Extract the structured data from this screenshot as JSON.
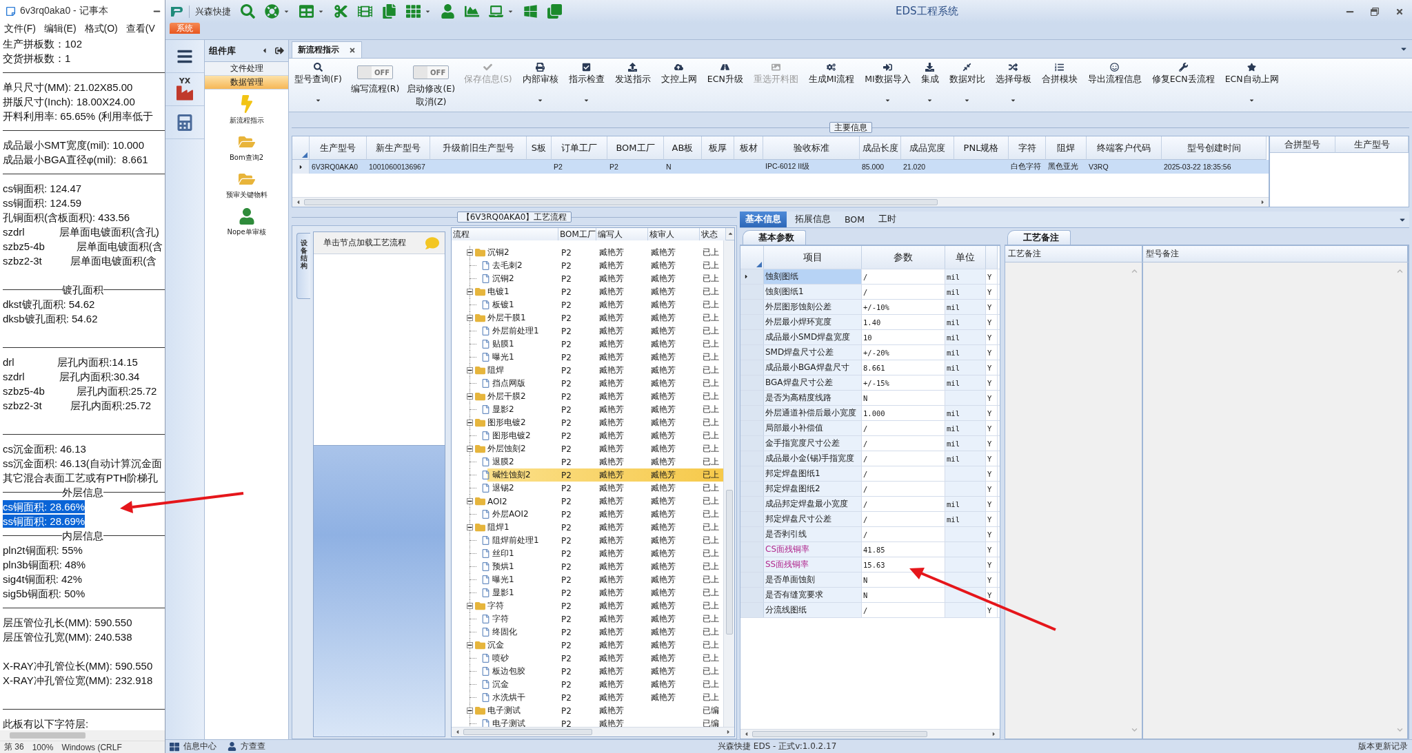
{
  "notepad": {
    "title": "6v3rq0aka0 - 记事本",
    "menu": [
      "文件(F)",
      "编辑(E)",
      "格式(O)",
      "查看(V"
    ],
    "lines": [
      {
        "kind": "text",
        "text": "生产拼板数：102",
        "selected": false
      },
      {
        "kind": "text",
        "text": "交货拼板数：1",
        "selected": false
      },
      {
        "kind": "rule"
      },
      {
        "kind": "text",
        "text": "单只尺寸(MM): 21.02X85.00",
        "selected": false
      },
      {
        "kind": "text",
        "text": "拼版尺寸(Inch): 18.00X24.00",
        "selected": false
      },
      {
        "kind": "text",
        "text": "开料利用率: 65.65% (利用率低于",
        "selected": false
      },
      {
        "kind": "rule"
      },
      {
        "kind": "text",
        "text": "成品最小SMT宽度(mil): 10.000",
        "selected": false
      },
      {
        "kind": "text",
        "text": "成品最小BGA直径φ(mil):  8.661",
        "selected": false
      },
      {
        "kind": "rule"
      },
      {
        "kind": "text",
        "text": "cs铜面积: 124.47",
        "selected": false
      },
      {
        "kind": "text",
        "text": "ss铜面积: 124.59",
        "selected": false
      },
      {
        "kind": "text",
        "text": "孔铜面积(含板面积): 433.56",
        "selected": false
      },
      {
        "kind": "text",
        "text": "szdrl            层单面电镀面积(含孔)",
        "selected": false
      },
      {
        "kind": "text",
        "text": "szbz5-4b           层单面电镀面积(含",
        "selected": false
      },
      {
        "kind": "text",
        "text": "szbz2-3t          层单面电镀面积(含",
        "selected": false
      },
      {
        "kind": "blank"
      },
      {
        "kind": "heading",
        "text": "镀孔面积"
      },
      {
        "kind": "text",
        "text": "dkst镀孔面积: 54.62",
        "selected": false
      },
      {
        "kind": "text",
        "text": "dksb镀孔面积: 54.62",
        "selected": false
      },
      {
        "kind": "blank"
      },
      {
        "kind": "rule"
      },
      {
        "kind": "text",
        "text": "drl               层孔内面积:14.15",
        "selected": false
      },
      {
        "kind": "text",
        "text": "szdrl            层孔内面积:30.34",
        "selected": false
      },
      {
        "kind": "text",
        "text": "szbz5-4b           层孔内面积:25.72",
        "selected": false
      },
      {
        "kind": "text",
        "text": "szbz2-3t          层孔内面积:25.72",
        "selected": false
      },
      {
        "kind": "blank"
      },
      {
        "kind": "rule"
      },
      {
        "kind": "text",
        "text": "cs沉金面积: 46.13",
        "selected": false
      },
      {
        "kind": "text",
        "text": "ss沉金面积: 46.13(自动计算沉金面",
        "selected": false
      },
      {
        "kind": "text",
        "text": "其它混合表面工艺或有PTH阶梯孔",
        "selected": false
      },
      {
        "kind": "heading",
        "text": "外层信息"
      },
      {
        "kind": "text",
        "text": "cs铜面积: 28.66%",
        "selected": true
      },
      {
        "kind": "text",
        "text": "ss铜面积: 28.69%",
        "selected": true
      },
      {
        "kind": "heading",
        "text": "内层信息"
      },
      {
        "kind": "text",
        "text": "pln2t铜面积: 55%",
        "selected": false
      },
      {
        "kind": "text",
        "text": "pln3b铜面积: 48%",
        "selected": false
      },
      {
        "kind": "text",
        "text": "sig4t铜面积: 42%",
        "selected": false
      },
      {
        "kind": "text",
        "text": "sig5b铜面积: 50%",
        "selected": false
      },
      {
        "kind": "rule"
      },
      {
        "kind": "text",
        "text": "层压管位孔长(MM): 590.550",
        "selected": false
      },
      {
        "kind": "text",
        "text": "层压管位孔宽(MM): 240.538",
        "selected": false
      },
      {
        "kind": "blank"
      },
      {
        "kind": "text",
        "text": "X-RAY冲孔管位长(MM): 590.550",
        "selected": false
      },
      {
        "kind": "text",
        "text": "X-RAY冲孔管位宽(MM): 232.918",
        "selected": false
      },
      {
        "kind": "blank"
      },
      {
        "kind": "rule"
      },
      {
        "kind": "text",
        "text": "此板有以下字符层:",
        "selected": false
      }
    ],
    "status": [
      "第 36",
      "100%",
      "Windows (CRLF"
    ]
  },
  "app": {
    "logo_text": "兴森快捷",
    "title": "EDS工程系统",
    "quick_tools": [
      {
        "dropdown": false
      },
      {
        "dropdown": true
      },
      {
        "dropdown": true
      },
      {
        "dropdown": false
      },
      {
        "dropdown": false
      },
      {
        "dropdown": false
      },
      {
        "dropdown": true
      },
      {
        "dropdown": false
      },
      {
        "dropdown": false
      },
      {
        "dropdown": true
      },
      {
        "dropdown": false
      },
      {
        "dropdown": false
      }
    ],
    "ribbon_tabs": [
      {
        "label": "系统",
        "selected": true
      }
    ],
    "sidebar_icons": [
      {
        "kind": "menu"
      },
      {
        "kind": "factory",
        "badge": "YX"
      },
      {
        "kind": "calculator"
      }
    ],
    "component_library": {
      "title": "组件库",
      "categories": [
        {
          "label": "文件处理",
          "selected": false
        },
        {
          "label": "数据管理",
          "selected": true
        }
      ],
      "items": [
        {
          "kind": "bolt",
          "label": "新流程指示"
        },
        {
          "kind": "folder",
          "label": "Bom查询2"
        },
        {
          "kind": "folder",
          "label": "预审关键物料"
        },
        {
          "kind": "user",
          "label": "Nope单审核"
        }
      ]
    },
    "doc_tabs": [
      {
        "label": "新流程指示",
        "selected": true
      }
    ],
    "toolbar": [
      {
        "kind": "button",
        "label": "型号查询(F)",
        "dropdown": true,
        "disabled": false
      },
      {
        "kind": "toggle",
        "label": "编写流程(R)",
        "state_label": "OFF",
        "on": false
      },
      {
        "kind": "toggle",
        "label": "启动修改(E)",
        "sublabel": "取消(Z)",
        "state_label": "OFF",
        "on": false
      },
      {
        "kind": "button",
        "label": "保存信息(S)",
        "dropdown": false,
        "disabled": true
      },
      {
        "kind": "button",
        "label": "内部审核",
        "dropdown": true,
        "disabled": false
      },
      {
        "kind": "button",
        "label": "指示检查",
        "dropdown": true,
        "disabled": false
      },
      {
        "kind": "button",
        "label": "发送指示",
        "dropdown": false,
        "disabled": false
      },
      {
        "kind": "button",
        "label": "文控上网",
        "dropdown": false,
        "disabled": false
      },
      {
        "kind": "button",
        "label": "ECN升级",
        "dropdown": false,
        "disabled": false
      },
      {
        "kind": "button",
        "label": "重选开料图",
        "dropdown": false,
        "disabled": true
      },
      {
        "kind": "button",
        "label": "生成MI流程",
        "dropdown": false,
        "disabled": false
      },
      {
        "kind": "button",
        "label": "MI数据导入",
        "dropdown": true,
        "disabled": false
      },
      {
        "kind": "button",
        "label": "集成",
        "dropdown": true,
        "disabled": false
      },
      {
        "kind": "button",
        "label": "数据对比",
        "dropdown": true,
        "disabled": false
      },
      {
        "kind": "button",
        "label": "选择母板",
        "dropdown": true,
        "disabled": false
      },
      {
        "kind": "button",
        "label": "合拼模块",
        "dropdown": false,
        "disabled": false
      },
      {
        "kind": "button",
        "label": "导出流程信息",
        "dropdown": false,
        "disabled": false
      },
      {
        "kind": "button",
        "label": "修复ECN丢流程",
        "dropdown": false,
        "disabled": false
      },
      {
        "kind": "button",
        "label": "ECN自动上网",
        "dropdown": true,
        "disabled": false
      }
    ],
    "main_info": {
      "legend": "主要信息",
      "columns": [
        "生产型号",
        "新生产型号",
        "升级前旧生产型号",
        "S板",
        "订单工厂",
        "BOM工厂",
        "AB板",
        "板厚",
        "板材",
        "验收标准",
        "成品长度",
        "成品宽度",
        "PNL规格",
        "字符",
        "阻焊",
        "终端客户代码",
        "型号创建时间"
      ],
      "rows": [
        {
          "selected": true,
          "cells": [
            "6V3RQ0AKA0",
            "10010600136967",
            "",
            "",
            "P2",
            "P2",
            "N",
            "",
            "",
            "IPC-6012 II级",
            "85.000",
            "21.020",
            "",
            "白色字符",
            "黑色亚光",
            "V3RQ",
            "2025-03-22 18:35:56"
          ]
        }
      ],
      "side_columns": [
        "合拼型号",
        "生产型号"
      ]
    },
    "process": {
      "legend": "【6V3RQ0AKA0】工艺流程",
      "side_tab": "设备结构",
      "hint": "单击节点加载工艺流程",
      "columns": [
        "流程",
        "BOM工厂",
        "编写人",
        "核审人",
        "状态"
      ],
      "tree": [
        {
          "name": "沉铜2",
          "factory": "P2",
          "author": "臧艳芳",
          "reviewer": "臧艳芳",
          "status": "已上",
          "selected": false,
          "expanded": true,
          "children": [
            {
              "name": "去毛刺2",
              "factory": "P2",
              "author": "臧艳芳",
              "reviewer": "臧艳芳",
              "status": "已上",
              "selected": false
            },
            {
              "name": "沉铜2",
              "factory": "P2",
              "author": "臧艳芳",
              "reviewer": "臧艳芳",
              "status": "已上",
              "selected": false
            }
          ]
        },
        {
          "name": "电镀1",
          "factory": "P2",
          "author": "臧艳芳",
          "reviewer": "臧艳芳",
          "status": "已上",
          "selected": false,
          "expanded": true,
          "children": [
            {
              "name": "板镀1",
              "factory": "P2",
              "author": "臧艳芳",
              "reviewer": "臧艳芳",
              "status": "已上",
              "selected": false
            }
          ]
        },
        {
          "name": "外层干膜1",
          "factory": "P2",
          "author": "臧艳芳",
          "reviewer": "臧艳芳",
          "status": "已上",
          "selected": false,
          "expanded": true,
          "children": [
            {
              "name": "外层前处理1",
              "factory": "P2",
              "author": "臧艳芳",
              "reviewer": "臧艳芳",
              "status": "已上",
              "selected": false
            },
            {
              "name": "贴膜1",
              "factory": "P2",
              "author": "臧艳芳",
              "reviewer": "臧艳芳",
              "status": "已上",
              "selected": false
            },
            {
              "name": "曝光1",
              "factory": "P2",
              "author": "臧艳芳",
              "reviewer": "臧艳芳",
              "status": "已上",
              "selected": false
            }
          ]
        },
        {
          "name": "阻焊",
          "factory": "P2",
          "author": "臧艳芳",
          "reviewer": "臧艳芳",
          "status": "已上",
          "selected": false,
          "expanded": true,
          "children": [
            {
              "name": "挡点网版",
              "factory": "P2",
              "author": "臧艳芳",
              "reviewer": "臧艳芳",
              "status": "已上",
              "selected": false
            }
          ]
        },
        {
          "name": "外层干膜2",
          "factory": "P2",
          "author": "臧艳芳",
          "reviewer": "臧艳芳",
          "status": "已上",
          "selected": false,
          "expanded": true,
          "children": [
            {
              "name": "显影2",
              "factory": "P2",
              "author": "臧艳芳",
              "reviewer": "臧艳芳",
              "status": "已上",
              "selected": false
            }
          ]
        },
        {
          "name": "图形电镀2",
          "factory": "P2",
          "author": "臧艳芳",
          "reviewer": "臧艳芳",
          "status": "已上",
          "selected": false,
          "expanded": true,
          "children": [
            {
              "name": "图形电镀2",
              "factory": "P2",
              "author": "臧艳芳",
              "reviewer": "臧艳芳",
              "status": "已上",
              "selected": false
            }
          ]
        },
        {
          "name": "外层蚀刻2",
          "factory": "P2",
          "author": "臧艳芳",
          "reviewer": "臧艳芳",
          "status": "已上",
          "selected": false,
          "expanded": true,
          "children": [
            {
              "name": "退膜2",
              "factory": "P2",
              "author": "臧艳芳",
              "reviewer": "臧艳芳",
              "status": "已上",
              "selected": false
            },
            {
              "name": "碱性蚀刻2",
              "factory": "P2",
              "author": "臧艳芳",
              "reviewer": "臧艳芳",
              "status": "已上",
              "selected": true
            },
            {
              "name": "退锡2",
              "factory": "P2",
              "author": "臧艳芳",
              "reviewer": "臧艳芳",
              "status": "已上",
              "selected": false
            }
          ]
        },
        {
          "name": "AOI2",
          "factory": "P2",
          "author": "臧艳芳",
          "reviewer": "臧艳芳",
          "status": "已上",
          "selected": false,
          "expanded": true,
          "children": [
            {
              "name": "外层AOI2",
              "factory": "P2",
              "author": "臧艳芳",
              "reviewer": "臧艳芳",
              "status": "已上",
              "selected": false
            }
          ]
        },
        {
          "name": "阻焊1",
          "factory": "P2",
          "author": "臧艳芳",
          "reviewer": "臧艳芳",
          "status": "已上",
          "selected": false,
          "expanded": true,
          "children": [
            {
              "name": "阻焊前处理1",
              "factory": "P2",
              "author": "臧艳芳",
              "reviewer": "臧艳芳",
              "status": "已上",
              "selected": false
            },
            {
              "name": "丝印1",
              "factory": "P2",
              "author": "臧艳芳",
              "reviewer": "臧艳芳",
              "status": "已上",
              "selected": false
            },
            {
              "name": "预烘1",
              "factory": "P2",
              "author": "臧艳芳",
              "reviewer": "臧艳芳",
              "status": "已上",
              "selected": false
            },
            {
              "name": "曝光1",
              "factory": "P2",
              "author": "臧艳芳",
              "reviewer": "臧艳芳",
              "status": "已上",
              "selected": false
            },
            {
              "name": "显影1",
              "factory": "P2",
              "author": "臧艳芳",
              "reviewer": "臧艳芳",
              "status": "已上",
              "selected": false
            }
          ]
        },
        {
          "name": "字符",
          "factory": "P2",
          "author": "臧艳芳",
          "reviewer": "臧艳芳",
          "status": "已上",
          "selected": false,
          "expanded": true,
          "children": [
            {
              "name": "字符",
              "factory": "P2",
              "author": "臧艳芳",
              "reviewer": "臧艳芳",
              "status": "已上",
              "selected": false
            },
            {
              "name": "终固化",
              "factory": "P2",
              "author": "臧艳芳",
              "reviewer": "臧艳芳",
              "status": "已上",
              "selected": false
            }
          ]
        },
        {
          "name": "沉金",
          "factory": "P2",
          "author": "臧艳芳",
          "reviewer": "臧艳芳",
          "status": "已上",
          "selected": false,
          "expanded": true,
          "children": [
            {
              "name": "喷砂",
              "factory": "P2",
              "author": "臧艳芳",
              "reviewer": "臧艳芳",
              "status": "已上",
              "selected": false
            },
            {
              "name": "板边包胶",
              "factory": "P2",
              "author": "臧艳芳",
              "reviewer": "臧艳芳",
              "status": "已上",
              "selected": false
            },
            {
              "name": "沉金",
              "factory": "P2",
              "author": "臧艳芳",
              "reviewer": "臧艳芳",
              "status": "已上",
              "selected": false
            },
            {
              "name": "水洗烘干",
              "factory": "P2",
              "author": "臧艳芳",
              "reviewer": "臧艳芳",
              "status": "已上",
              "selected": false
            }
          ]
        },
        {
          "name": "电子测试",
          "factory": "P2",
          "author": "臧艳芳",
          "status": "已编",
          "selected": false,
          "expanded": true,
          "children": [
            {
              "name": "电子测试",
              "factory": "P2",
              "author": "臧艳芳",
              "status": "已编",
              "selected": false
            }
          ]
        }
      ]
    },
    "details": {
      "tabs": [
        {
          "label": "基本信息",
          "selected": true
        },
        {
          "label": "拓展信息",
          "selected": false
        },
        {
          "label": "BOM",
          "selected": false
        },
        {
          "label": "工时",
          "selected": false
        }
      ],
      "params": {
        "title": "基本参数",
        "columns": [
          "项目",
          "参数",
          "单位"
        ],
        "rows": [
          {
            "item": "蚀刻图纸",
            "value": "/",
            "unit": "mil",
            "flag": "Y",
            "flagged": false,
            "selected": true
          },
          {
            "item": "蚀刻图纸1",
            "value": "/",
            "unit": "mil",
            "flag": "Y",
            "flagged": false,
            "selected": false
          },
          {
            "item": "外层图形蚀刻公差",
            "value": "+/-10%",
            "unit": "mil",
            "flag": "Y",
            "flagged": false,
            "selected": false
          },
          {
            "item": "外层最小焊环宽度",
            "value": "1.40",
            "unit": "mil",
            "flag": "Y",
            "flagged": false,
            "selected": false
          },
          {
            "item": "成品最小SMD焊盘宽度",
            "value": "10",
            "unit": "mil",
            "flag": "Y",
            "flagged": false,
            "selected": false
          },
          {
            "item": "SMD焊盘尺寸公差",
            "value": "+/-20%",
            "unit": "mil",
            "flag": "Y",
            "flagged": false,
            "selected": false
          },
          {
            "item": "成品最小BGA焊盘尺寸",
            "value": "8.661",
            "unit": "mil",
            "flag": "Y",
            "flagged": false,
            "selected": false
          },
          {
            "item": "BGA焊盘尺寸公差",
            "value": "+/-15%",
            "unit": "mil",
            "flag": "Y",
            "flagged": false,
            "selected": false
          },
          {
            "item": "是否为高精度线路",
            "value": "N",
            "flag": "Y",
            "flagged": false,
            "selected": false
          },
          {
            "item": "外层通道补偿后最小宽度",
            "value": "1.000",
            "unit": "mil",
            "flag": "Y",
            "flagged": false,
            "selected": false
          },
          {
            "item": "局部最小补偿值",
            "value": "/",
            "unit": "mil",
            "flag": "Y",
            "flagged": false,
            "selected": false
          },
          {
            "item": "金手指宽度尺寸公差",
            "value": "/",
            "unit": "mil",
            "flag": "Y",
            "flagged": false,
            "selected": false
          },
          {
            "item": "成品最小金(锡)手指宽度",
            "value": "/",
            "unit": "mil",
            "flag": "Y",
            "flagged": false,
            "selected": false
          },
          {
            "item": "邦定焊盘图纸1",
            "value": "/",
            "flag": "Y",
            "flagged": false,
            "selected": false
          },
          {
            "item": "邦定焊盘图纸2",
            "value": "/",
            "flag": "Y",
            "flagged": false,
            "selected": false
          },
          {
            "item": "成品邦定焊盘最小宽度",
            "value": "/",
            "unit": "mil",
            "flag": "Y",
            "flagged": false,
            "selected": false
          },
          {
            "item": "邦定焊盘尺寸公差",
            "value": "/",
            "unit": "mil",
            "flag": "Y",
            "flagged": false,
            "selected": false
          },
          {
            "item": "是否剥引线",
            "value": "/",
            "flag": "Y",
            "flagged": false,
            "selected": false
          },
          {
            "item": "CS面残铜率",
            "value": "41.85",
            "flag": "Y",
            "flagged": true,
            "selected": false
          },
          {
            "item": "SS面残铜率",
            "value": "15.63",
            "flag": "Y",
            "flagged": true,
            "selected": false
          },
          {
            "item": "是否单面蚀刻",
            "value": "N",
            "flag": "Y",
            "flagged": false,
            "selected": false
          },
          {
            "item": "是否有缝宽要求",
            "value": "N",
            "flag": "Y",
            "flagged": false,
            "selected": false
          },
          {
            "item": "分流线图纸",
            "value": "/",
            "flag": "Y",
            "flagged": false,
            "selected": false
          }
        ]
      },
      "notes": {
        "title": "工艺备注",
        "columns": [
          "工艺备注",
          "型号备注"
        ]
      }
    },
    "status_bar": {
      "left": [
        {
          "kind": "grid",
          "label": "信息中心"
        },
        {
          "kind": "user",
          "label": "方查查"
        }
      ],
      "center": "兴森快捷 EDS - 正式v:1.0.2.17",
      "right": "版本更新记录"
    }
  }
}
